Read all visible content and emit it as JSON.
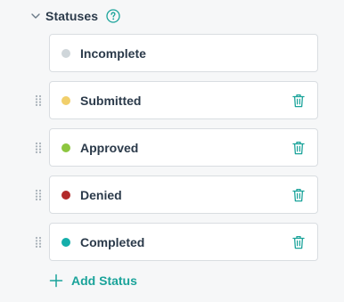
{
  "header": {
    "title": "Statuses",
    "expanded": true,
    "chevron_icon": "chevron-down-icon",
    "help_icon": "question-circle-icon"
  },
  "statuses": [
    {
      "label": "Incomplete",
      "color": "#cfd6da",
      "draggable": false,
      "deletable": false
    },
    {
      "label": "Submitted",
      "color": "#f1cf6b",
      "draggable": true,
      "deletable": true
    },
    {
      "label": "Approved",
      "color": "#8dc63f",
      "draggable": true,
      "deletable": true
    },
    {
      "label": "Denied",
      "color": "#b22a2a",
      "draggable": true,
      "deletable": true
    },
    {
      "label": "Completed",
      "color": "#14aeaa",
      "draggable": true,
      "deletable": true
    }
  ],
  "add_button": {
    "label": "Add Status",
    "icon": "plus-icon"
  },
  "colors": {
    "accent": "#1aa39a",
    "text": "#2b3a4a",
    "border": "#d9dde1",
    "background": "#f6f7f8"
  }
}
